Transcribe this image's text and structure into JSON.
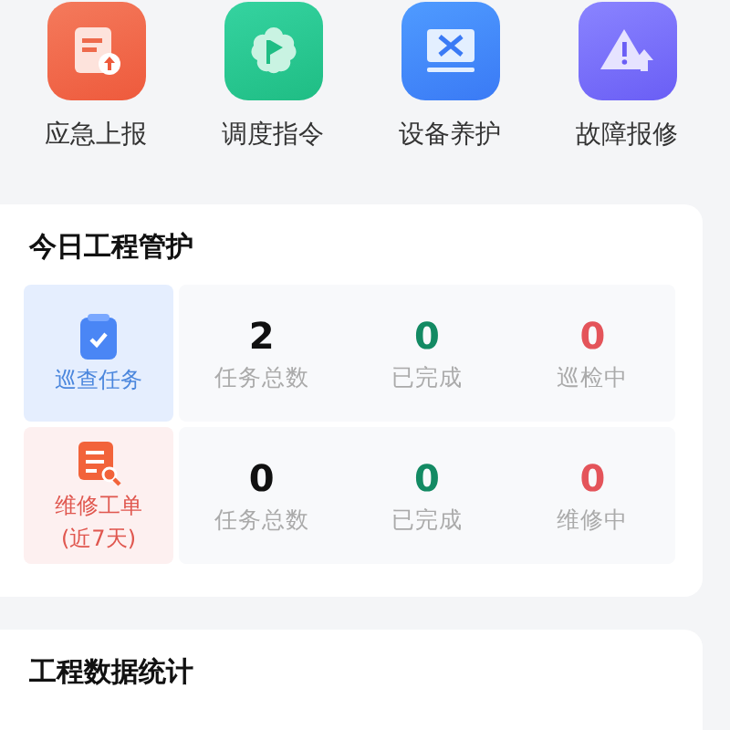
{
  "shortcuts": [
    {
      "label": "应急上报",
      "kind": "report"
    },
    {
      "label": "调度指令",
      "kind": "dispatch"
    },
    {
      "label": "设备养护",
      "kind": "maintain"
    },
    {
      "label": "故障报修",
      "kind": "fault"
    }
  ],
  "today_card": {
    "title": "今日工程管护",
    "rows": [
      {
        "kind": "patrol",
        "label": "巡查任务",
        "stats": [
          {
            "kind": "total",
            "value": "2",
            "label": "任务总数"
          },
          {
            "kind": "done",
            "value": "0",
            "label": "已完成"
          },
          {
            "kind": "active",
            "value": "0",
            "label": "巡检中"
          }
        ]
      },
      {
        "kind": "repair",
        "label": "维修工单",
        "sublabel": "(近7天)",
        "stats": [
          {
            "kind": "total",
            "value": "0",
            "label": "任务总数"
          },
          {
            "kind": "done",
            "value": "0",
            "label": "已完成"
          },
          {
            "kind": "active",
            "value": "0",
            "label": "维修中"
          }
        ]
      }
    ]
  },
  "stats_card": {
    "title": "工程数据统计"
  }
}
